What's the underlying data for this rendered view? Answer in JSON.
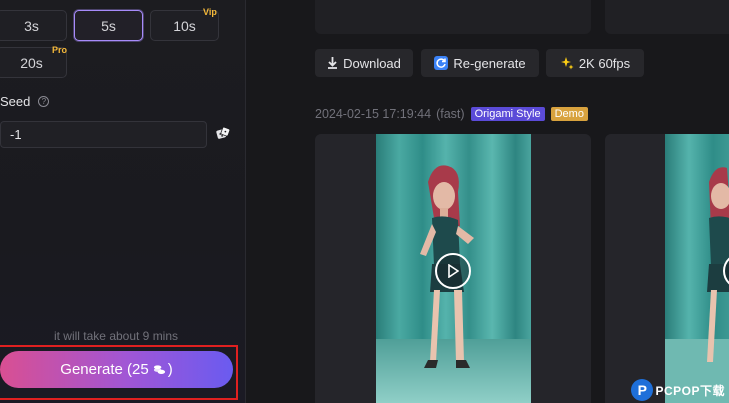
{
  "duration": {
    "options": [
      {
        "label": "3s",
        "tag": ""
      },
      {
        "label": "5s",
        "tag": ""
      },
      {
        "label": "10s",
        "tag": "Vip"
      },
      {
        "label": "20s",
        "tag": "Pro"
      }
    ],
    "selected": "5s"
  },
  "seed": {
    "label": "Seed",
    "help": "?",
    "value": "-1"
  },
  "generate": {
    "time_note": "it will take about 9 mins",
    "label": "Generate (25",
    "suffix": ")"
  },
  "actions": {
    "download": "Download",
    "regenerate": "Re-generate",
    "upscale": "2K 60fps"
  },
  "result": {
    "timestamp": "2024-02-15 17:19:44",
    "mode": "(fast)",
    "style_badge": "Origami Style",
    "demo_badge": "Demo"
  },
  "watermark": {
    "brand": "PCPOP下载"
  },
  "colors": {
    "accent": "#a78bfa",
    "tier": "#f5b93a",
    "style_badge": "#5b4bd8",
    "demo_badge": "#d8a23e",
    "highlight": "#e02020"
  }
}
